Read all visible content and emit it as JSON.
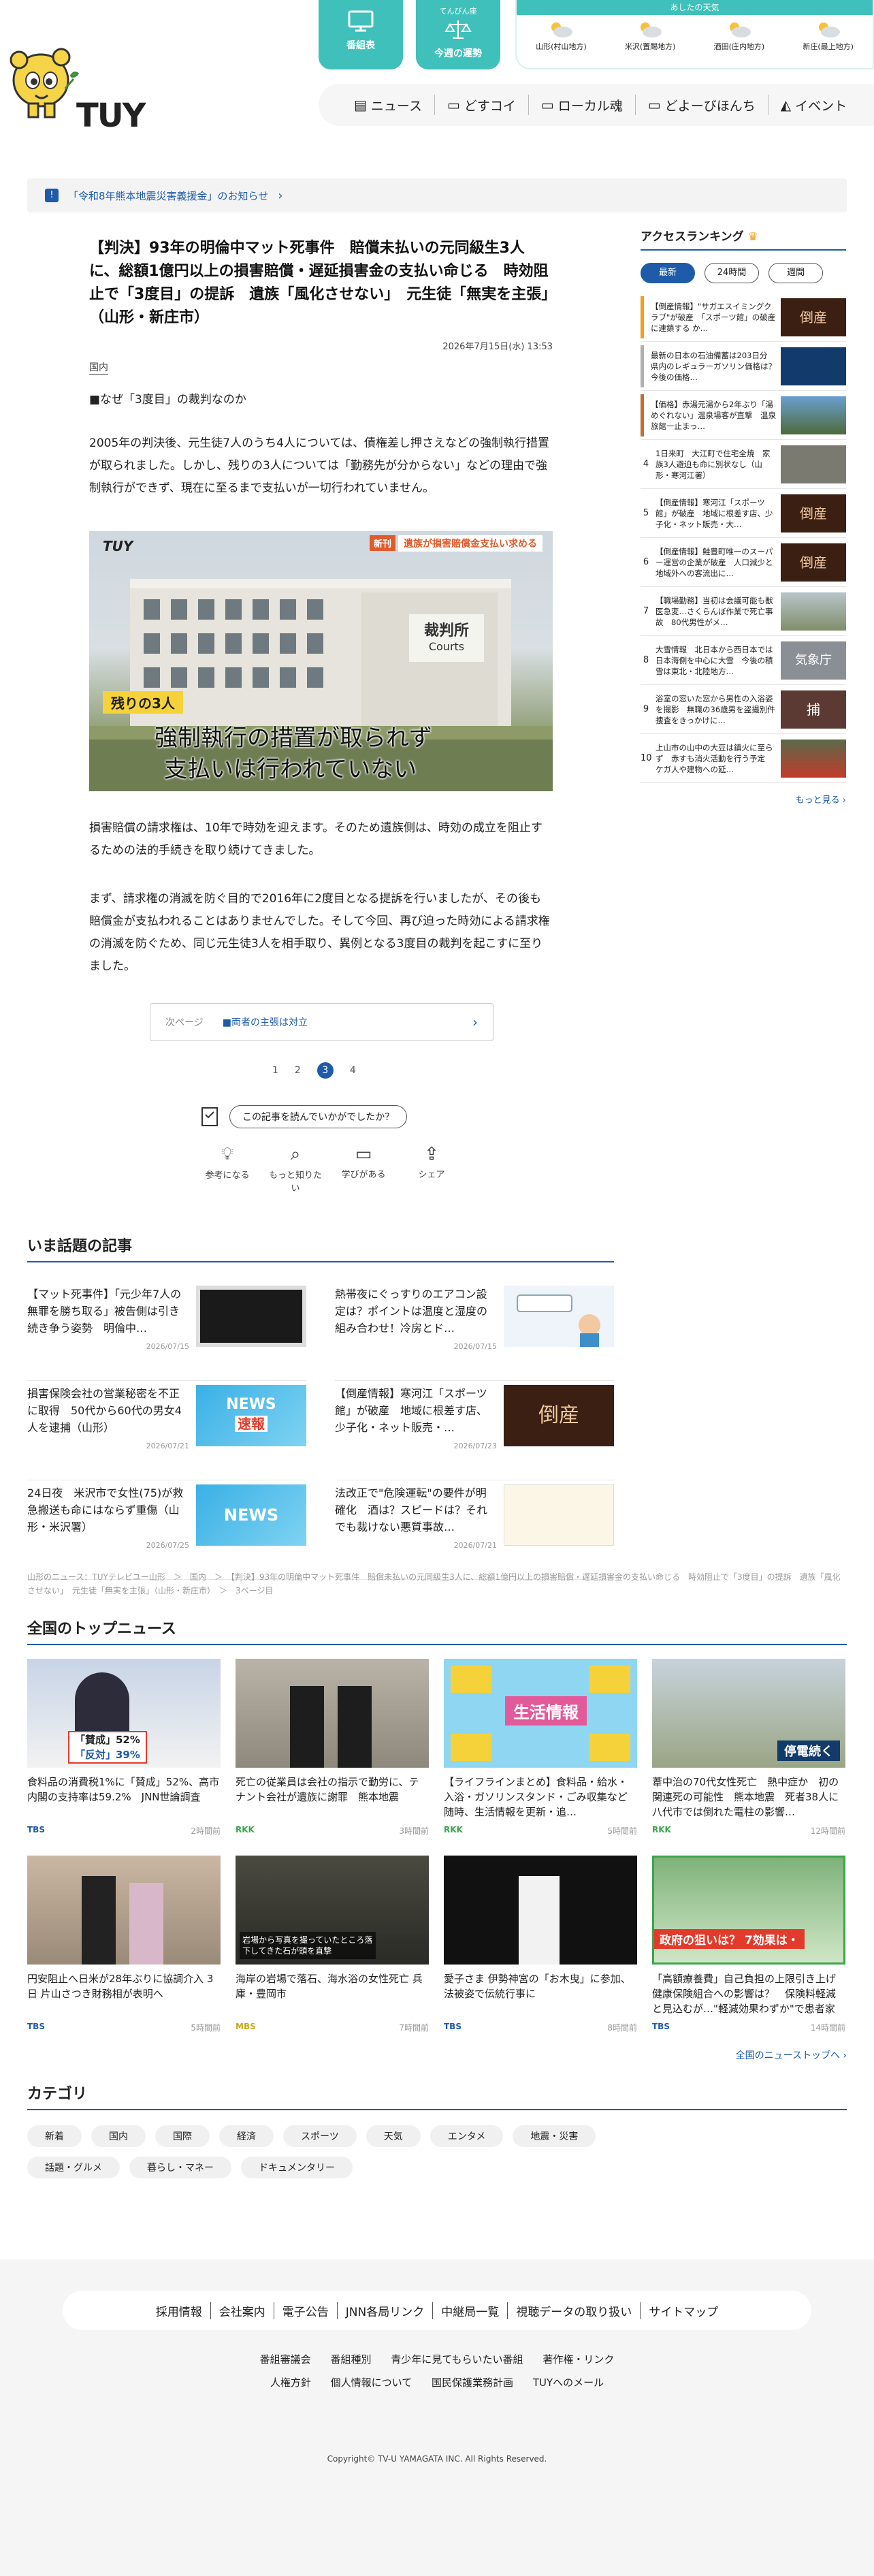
{
  "header": {
    "logo": "TUY",
    "btn_program": "番組表",
    "btn_fortune_small": "てんびん座",
    "btn_fortune": "今週の運勢",
    "weather_title": "あしたの天気",
    "weather": [
      {
        "label": "山形(村山地方)"
      },
      {
        "label": "米沢(置賜地方)"
      },
      {
        "label": "酒田(庄内地方)"
      },
      {
        "label": "新庄(最上地方)"
      }
    ],
    "nav": [
      {
        "label": "ニュース",
        "icon": "newspaper-icon"
      },
      {
        "label": "どすコイ",
        "icon": "tv-icon"
      },
      {
        "label": "ローカル魂",
        "icon": "tv-icon"
      },
      {
        "label": "どよーびほんち",
        "icon": "tv-icon"
      },
      {
        "label": "イベント",
        "icon": "megaphone-icon"
      }
    ]
  },
  "banner": {
    "mark": "!",
    "text": "「令和8年熊本地震災害義援金」のお知らせ",
    "chevron": "›"
  },
  "article": {
    "title": "【判決】93年の明倫中マット死事件　賠償未払いの元同級生3人に、総額1億円以上の損害賠償・遅延損害金の支払い命じる　時効阻止で「3度目」の提訴　遺族「風化させない」　元生徒「無実を主張」（山形・新庄市）",
    "date": "2026年7月15日(水) 13:53",
    "category": "国内",
    "subhead": "■なぜ「3度目」の裁判なのか",
    "p1": "2005年の判決後、元生徒7人のうち4人については、債権差し押さえなどの強制執行措置が取られました。しかし、残りの3人については「勤務先が分からない」などの理由で強制執行ができず、現在に至るまで支払いが一切行われていません。",
    "photo": {
      "logo": "TUY",
      "badge": "新刊",
      "topcap": "遺族が損害賠償金支払い求める",
      "sign": "裁判所",
      "sign_en": "Courts",
      "tag": "残りの3人",
      "cap1": "強制執行の措置が取られず",
      "cap2": "支払いは行われていない"
    },
    "p2": "損害賠償の請求権は、10年で時効を迎えます。そのため遺族側は、時効の成立を阻止するための法的手続きを取り続けてきました。",
    "p3": "まず、請求権の消滅を防ぐ目的で2016年に2度目となる提訴を行いましたが、その後も賠償金が支払われることはありませんでした。そして今回、再び迫った時効による請求権の消滅を防ぐため、同じ元生徒3人を相手取り、異例となる3度目の裁判を起こすに至りました。",
    "next_label": "次ページ",
    "next_text": "■両者の主張は対立",
    "pages": [
      "1",
      "2",
      "3",
      "4"
    ],
    "survey": "この記事を読んでいかがでしたか？",
    "reactions": [
      {
        "label": "参考になる",
        "icon": "lightbulb-icon"
      },
      {
        "label": "もっと知りたい",
        "icon": "search-icon"
      },
      {
        "label": "学びがある",
        "icon": "book-icon"
      },
      {
        "label": "シェア",
        "icon": "share-icon"
      }
    ]
  },
  "ranking": {
    "title": "アクセスランキング",
    "tabs": [
      "最新",
      "24時間",
      "週間"
    ],
    "items": [
      {
        "num": "1",
        "text": "【倒産情報】\"サガエスイミングクラブ\"が破産　「スポーツ館」の破産に連鎖する か…",
        "bar": "#f0a020"
      },
      {
        "num": "2",
        "text": "最新の日本の石油備蓄は203日分　県内のレギュラーガソリン価格は？今後の価格…",
        "bar": "#b0b0b0"
      },
      {
        "num": "3",
        "text": "【価格】赤湯元湯から2年ぶり「湯めぐれない」温泉場客が直撃　温泉旅館一止まっ…",
        "bar": "#c07030"
      },
      {
        "num": "4",
        "text": "1日来町　大江町で住宅全焼　家族3人避迫も命に別状なし（山形・寒河江署）",
        "bar": "#ccc"
      },
      {
        "num": "5",
        "text": "【倒産情報】寒河江「スポーツ館」が破産　地域に根差す店、少子化・ネット販売・大…",
        "bar": "#ccc"
      },
      {
        "num": "6",
        "text": "【倒産情報】鮭豊町唯一のスーパー運営の企業が破産　人口減少と地域外への客流出に…",
        "bar": "#ccc"
      },
      {
        "num": "7",
        "text": "【職場勤務】当初は会議可能も獣医急変…さくらんぼ作業で死亡事故　80代男性がメ…",
        "bar": "#ccc"
      },
      {
        "num": "8",
        "text": "大雪情報　北日本から西日本では日本海側を中心に大雪　今後の積雪は東北・北陸地方…",
        "bar": "#ccc"
      },
      {
        "num": "9",
        "text": "浴室の窓いた窓から男性の入浴姿を撮影　無職の36歳男を盗撮別件捜査をきっかけに…",
        "bar": "#ccc"
      },
      {
        "num": "10",
        "text": "上山市の山中の大豆は鎮火に至らず　赤すも消火活動を行う予定　ケガ人や建物への延…",
        "bar": "#ccc"
      }
    ],
    "more": "もっと見る ›"
  },
  "trending": {
    "title": "いま話題の記事",
    "items": [
      {
        "text": "【マット死事件】「元少年7人の無罪を勝ち取る」被告側は引き続き争う姿勢　明倫中…",
        "date": "2026/07/15",
        "thumb": "dark"
      },
      {
        "text": "熱帯夜にぐっすりのエアコン設定は？ポイントは温度と湿度の組み合わせ！冷房とド…",
        "date": "2026/07/15",
        "thumb": "ac"
      },
      {
        "text": "損害保険会社の営業秘密を不正に取得　50代から60代の男女4人を逮捕（山形）",
        "date": "2026/07/21",
        "thumb": "news1"
      },
      {
        "text": "【倒産情報】寒河江「スポーツ館」が破産　地域に根差す店、少子化・ネット販売・…",
        "date": "2026/07/23",
        "thumb": "bankrupt"
      },
      {
        "text": "24日夜　米沢市で女性(75)が救急搬送も命にはならず重傷（山形・米沢署）",
        "date": "2026/07/25",
        "thumb": "news2"
      },
      {
        "text": "法改正で\"危険運転\"の要件が明確化　酒は？スピードは？それでも裁けない悪質事故…",
        "date": "2026/07/21",
        "thumb": "road"
      }
    ]
  },
  "breadcrumb": "山形のニュース：TUYテレビユー山形　＞　国内　＞　【判決】93年の明倫中マット死事件　賠償未払いの元同級生3人に、総額1億円以上の損害賠償・遅延損害金の支払い命じる　時効阻止で「3度目」の提訴　遺族「風化させない」　元生徒「無実を主張」（山形・新庄市）　＞　3ページ目",
  "national": {
    "title": "全国のトップニュース",
    "items": [
      {
        "text": "食料品の消費税1%に「賛成」52%、高市内閣の支持率は59.2%　JNN世論調査",
        "src": "TBS",
        "time": "2時間前",
        "thumb": "poll",
        "cap1": "「賛成」52%",
        "cap2": "「反対」39%"
      },
      {
        "text": "死亡の従業員は会社の指示で勤労に、テナント会社が遺族に謝罪　熊本地震",
        "src": "RKK",
        "time": "3時間前",
        "thumb": "suit"
      },
      {
        "text": "【ライフラインまとめ】食料品・給水・入浴・ガソリンスタンド・ごみ収集など　随時、生活情報を更新・追…",
        "src": "RKK",
        "time": "5時間前",
        "thumb": "life",
        "cap1": "生活情報"
      },
      {
        "text": "葦中治の70代女性死亡　熱中症か　初の関連死の可能性　熊本地震　死者38人に　八代市では倒れた電柱の影響…",
        "src": "RKK",
        "time": "12時間前",
        "thumb": "quake",
        "cap1": "停電続く"
      },
      {
        "text": "円安阻止へ日米が28年ぶりに協調介入 3日 片山さつき財務相が表明へ",
        "src": "TBS",
        "time": "5時間前",
        "thumb": "meet"
      },
      {
        "text": "海岸の岩場で落石、海水浴の女性死亡 兵庫・豊岡市",
        "src": "MBS",
        "time": "7時間前",
        "thumb": "rock",
        "cap1": "岩場から写真を撮っていたところ落下してきた石が頭を直撃"
      },
      {
        "text": "愛子さま 伊勢神宮の「お木曳」に参加、法被姿で伝統行事に",
        "src": "TBS",
        "time": "8時間前",
        "thumb": "shrine"
      },
      {
        "text": "「高額療養費」自己負担の上限引き上げ　健康保険組合への影響は？　保険料軽減と見込むが…\"軽減効果わずか\"で患者家計…",
        "src": "TBS",
        "time": "14時間前",
        "thumb": "health",
        "cap1": "政府の狙いは？ 7効果は・"
      }
    ],
    "more": "全国のニューストップへ ›"
  },
  "categories": {
    "title": "カテゴリ",
    "items": [
      "新着",
      "国内",
      "国際",
      "経済",
      "スポーツ",
      "天気",
      "エンタメ",
      "地震・災害",
      "話題・グルメ",
      "暮らし・マネー",
      "ドキュメンタリー"
    ]
  },
  "footer": {
    "main": [
      "採用情報",
      "会社案内",
      "電子公告",
      "JNN各局リンク",
      "中継局一覧",
      "視聴データの取り扱い",
      "サイトマップ"
    ],
    "row1": [
      "番組審議会",
      "番組種別",
      "青少年に見てもらいたい番組",
      "著作権・リンク"
    ],
    "row2": [
      "人権方針",
      "個人情報について",
      "国民保護業務計画",
      "TUYへのメール"
    ],
    "copyright": "Copyright© TV-U YAMAGATA INC. All Rights Reserved."
  },
  "colors": {
    "accent": "#3fc0ba",
    "brand_blue": "#1e5ba8",
    "rank_gold": "#f0a020"
  }
}
